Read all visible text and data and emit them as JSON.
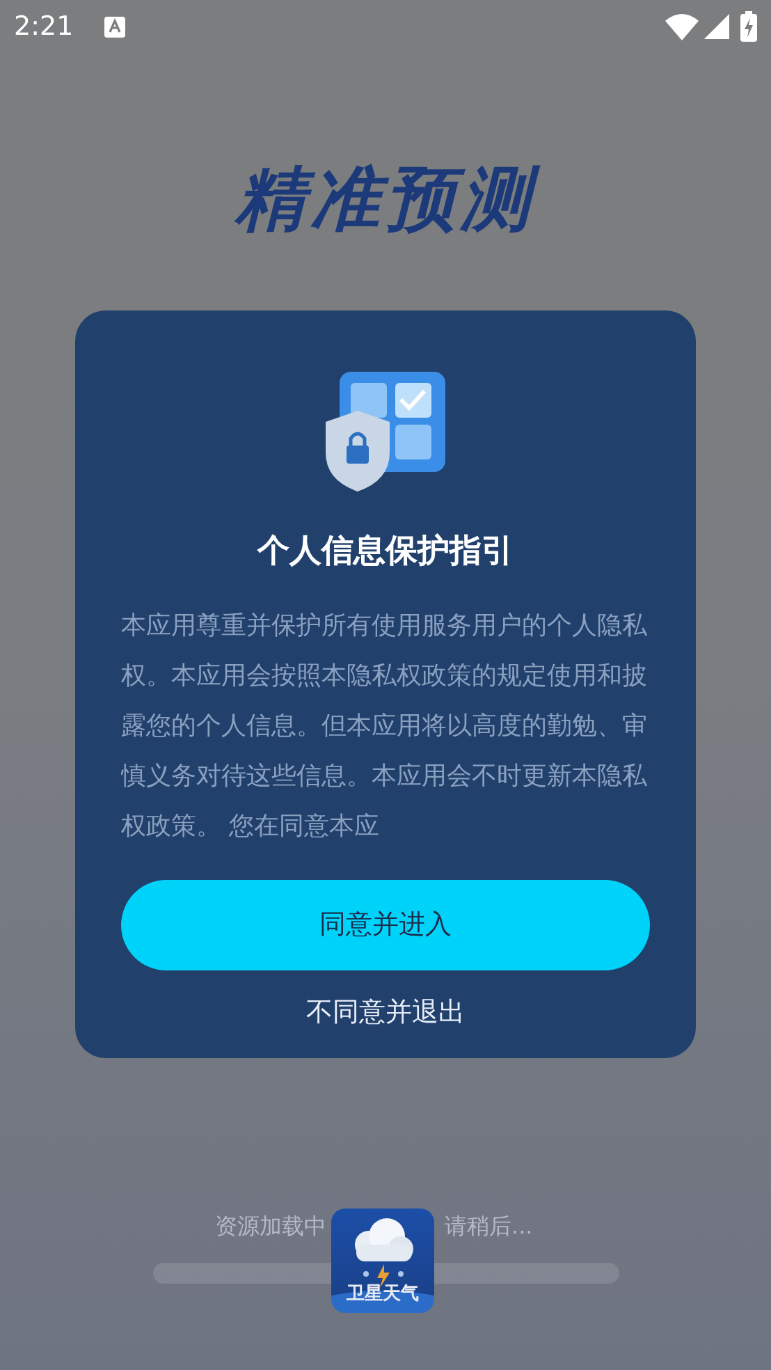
{
  "status_bar": {
    "time": "2:21"
  },
  "slogan": [
    "精准预测"
  ],
  "dialog": {
    "title": "个人信息保护指引",
    "body": "本应用尊重并保护所有使用服务用户的个人隐私权。本应用会按照本隐私权政策的规定使用和披露您的个人信息。但本应用将以高度的勤勉、审慎义务对待这些信息。本应用会不时更新本隐私权政策。 您在同意本应",
    "buttons": [
      {
        "kind": "primary",
        "label": "同意并进入"
      },
      {
        "kind": "link",
        "label": "不同意并退出"
      }
    ]
  },
  "loading": {
    "texts": [
      "资源加载中",
      "请稍后..."
    ],
    "logo_text": "卫星天气"
  }
}
